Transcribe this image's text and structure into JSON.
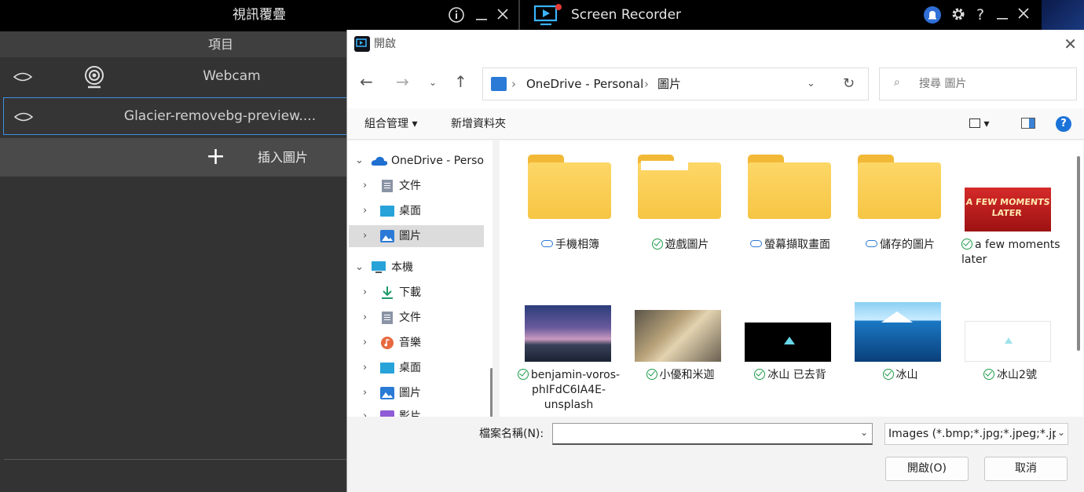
{
  "overlay": {
    "title": "視訊覆疊",
    "header": "項目",
    "rows": [
      {
        "label": "Webcam"
      },
      {
        "label": "Glacier-removebg-preview...."
      }
    ],
    "insert_label": "插入圖片"
  },
  "recorder": {
    "title": "Screen Recorder"
  },
  "dialog": {
    "title": "開啟",
    "address": {
      "segments": [
        "OneDrive - Personal",
        "圖片"
      ]
    },
    "search_placeholder": "搜尋 圖片",
    "toolbar": {
      "organize": "組合管理",
      "new_folder": "新增資料夾"
    },
    "tree": [
      {
        "label": "OneDrive - Perso",
        "icon": "onedrive-icon"
      },
      {
        "label": "文件",
        "icon": "documents-icon"
      },
      {
        "label": "桌面",
        "icon": "desktop-icon"
      },
      {
        "label": "圖片",
        "icon": "pictures-icon"
      },
      {
        "label": "本機",
        "icon": "this-pc-icon"
      },
      {
        "label": "下載",
        "icon": "downloads-icon"
      },
      {
        "label": "文件",
        "icon": "documents-icon"
      },
      {
        "label": "音樂",
        "icon": "music-icon"
      },
      {
        "label": "桌面",
        "icon": "desktop-icon"
      },
      {
        "label": "圖片",
        "icon": "pictures-icon"
      },
      {
        "label": "影片",
        "icon": "videos-icon"
      }
    ],
    "items": [
      {
        "name": "手機相簿",
        "status": "cloud",
        "kind": "folder"
      },
      {
        "name": "遊戲圖片",
        "status": "synced",
        "kind": "folder"
      },
      {
        "name": "螢幕擷取畫面",
        "status": "cloud",
        "kind": "folder"
      },
      {
        "name": "儲存的圖片",
        "status": "cloud",
        "kind": "folder"
      },
      {
        "name": "a few moments later",
        "status": "synced",
        "kind": "image",
        "thumb_text": "A FEW MOMENTS LATER"
      },
      {
        "name": "benjamin-voros-phIFdC6IA4E-unsplash",
        "status": "synced",
        "kind": "image"
      },
      {
        "name": "小優和米迦",
        "status": "synced",
        "kind": "image"
      },
      {
        "name": "冰山 已去背",
        "status": "synced",
        "kind": "image"
      },
      {
        "name": "冰山",
        "status": "synced",
        "kind": "image"
      },
      {
        "name": "冰山2號",
        "status": "synced",
        "kind": "image"
      }
    ],
    "filename_label": "檔案名稱(N):",
    "filename_value": "",
    "filter": "Images (*.bmp;*.jpg;*.jpeg;*.jp",
    "open_button": "開啟(O)",
    "cancel_button": "取消"
  },
  "colors": {
    "accent": "#1a73d9",
    "synced": "#1f9b4a",
    "folder": "#f6c544"
  }
}
